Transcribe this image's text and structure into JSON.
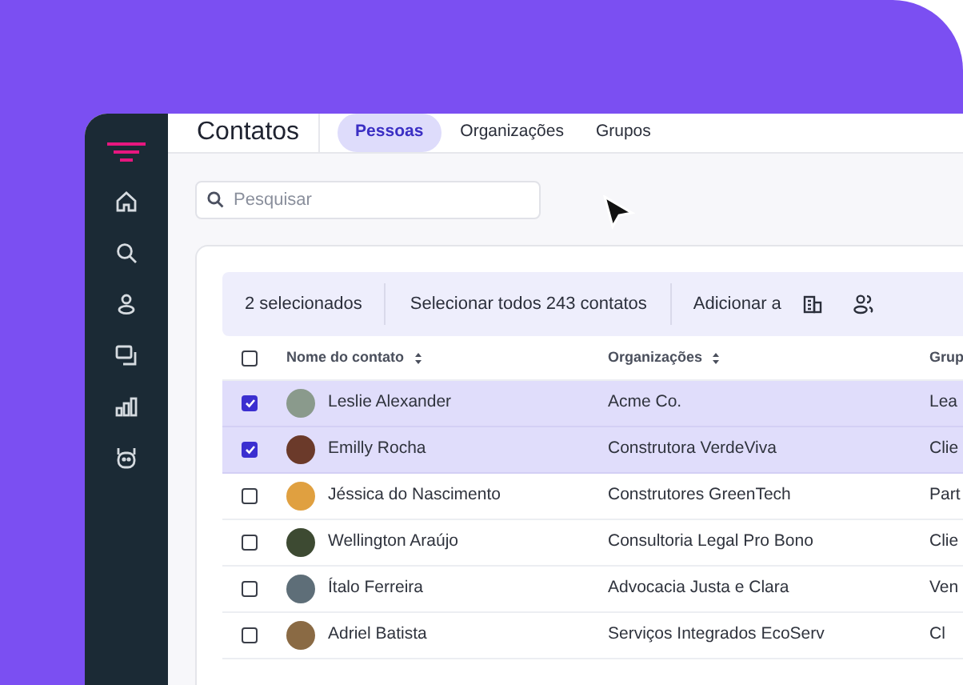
{
  "header": {
    "title": "Contatos",
    "tabs": [
      {
        "label": "Pessoas",
        "selected": true
      },
      {
        "label": "Organizações",
        "selected": false
      },
      {
        "label": "Grupos",
        "selected": false
      }
    ]
  },
  "search": {
    "placeholder": "Pesquisar"
  },
  "selection_bar": {
    "count": "2 selecionados",
    "select_all": "Selecionar todos 243 contatos",
    "add_to": "Adicionar a"
  },
  "table": {
    "all_checked": false,
    "columns": [
      "Nome do contato",
      "Organizações",
      "Grup"
    ],
    "rows": [
      {
        "name": "Leslie Alexander",
        "organization": "Acme Co.",
        "column_3": "Lea",
        "selected": true
      },
      {
        "name": "Emilly Rocha",
        "organization": "Construtora VerdeViva",
        "column_3": "Clie",
        "selected": true
      },
      {
        "name": "Jéssica do Nascimento",
        "organization": "Construtores GreenTech",
        "column_3": "Part",
        "selected": false
      },
      {
        "name": "Wellington Araújo",
        "organization": "Consultoria Legal Pro Bono",
        "column_3": "Clie",
        "selected": false
      },
      {
        "name": "Ítalo Ferreira",
        "organization": "Advocacia Justa e Clara",
        "column_3": "Ven",
        "selected": false
      },
      {
        "name": "Adriel Batista",
        "organization": "Serviços Integrados EcoServ",
        "column_3": "Cl",
        "selected": false
      }
    ]
  }
}
